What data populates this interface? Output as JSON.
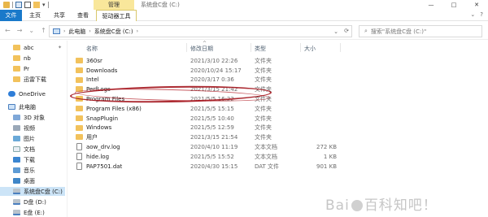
{
  "titlebar": {
    "manage_tab": "管理",
    "window_title": "系统盘C盘 (C:)",
    "minimize": "—",
    "maximize": "□",
    "close": "✕"
  },
  "ribbon": {
    "tabs": [
      "文件",
      "主页",
      "共享",
      "查看",
      "驱动器工具"
    ],
    "expand": "⌄",
    "help": "?"
  },
  "address": {
    "path": [
      "此电脑",
      "系统盘C盘 (C:)"
    ],
    "sep": "›",
    "search_placeholder": "搜索\"系统盘C盘 (C:)\""
  },
  "sidebar": {
    "items": [
      {
        "label": "abc",
        "icon": "folder-icon"
      },
      {
        "label": "nb",
        "icon": "folder-icon"
      },
      {
        "label": "Pr",
        "icon": "folder-icon"
      },
      {
        "label": "迅雷下载",
        "icon": "folder-icon"
      },
      {
        "label": "OneDrive",
        "icon": "cloud-icon"
      },
      {
        "label": "此电脑",
        "icon": "pc-icon"
      },
      {
        "label": "3D 对象",
        "icon": "cube-icon"
      },
      {
        "label": "视频",
        "icon": "video-icon"
      },
      {
        "label": "图片",
        "icon": "picture-icon"
      },
      {
        "label": "文档",
        "icon": "document-icon"
      },
      {
        "label": "下载",
        "icon": "download-icon"
      },
      {
        "label": "音乐",
        "icon": "music-icon"
      },
      {
        "label": "桌面",
        "icon": "desktop-icon"
      },
      {
        "label": "系统盘C盘 (C:)",
        "icon": "drive-icon"
      },
      {
        "label": "D盘 (D:)",
        "icon": "drive-icon"
      },
      {
        "label": "E盘 (E:)",
        "icon": "drive-icon"
      }
    ]
  },
  "columns": {
    "name": "名称",
    "date": "修改日期",
    "type": "类型",
    "size": "大小"
  },
  "files": [
    {
      "name": "360sr",
      "date": "2021/3/10 22:26",
      "type": "文件夹",
      "size": "",
      "kind": "folder"
    },
    {
      "name": "Downloads",
      "date": "2020/10/24 15:17",
      "type": "文件夹",
      "size": "",
      "kind": "folder"
    },
    {
      "name": "Intel",
      "date": "2020/3/17 0:36",
      "type": "文件夹",
      "size": "",
      "kind": "folder"
    },
    {
      "name": "PerfLogs",
      "date": "2021/3/15 21:42",
      "type": "文件夹",
      "size": "",
      "kind": "folder"
    },
    {
      "name": "Program Files",
      "date": "2021/5/5 16:22",
      "type": "文件夹",
      "size": "",
      "kind": "folder"
    },
    {
      "name": "Program Files (x86)",
      "date": "2021/5/5 15:15",
      "type": "文件夹",
      "size": "",
      "kind": "folder"
    },
    {
      "name": "SnapPlugin",
      "date": "2021/5/5 10:40",
      "type": "文件夹",
      "size": "",
      "kind": "folder"
    },
    {
      "name": "Windows",
      "date": "2021/5/5 12:59",
      "type": "文件夹",
      "size": "",
      "kind": "folder"
    },
    {
      "name": "用户",
      "date": "2021/3/15 21:54",
      "type": "文件夹",
      "size": "",
      "kind": "folder"
    },
    {
      "name": "aow_drv.log",
      "date": "2020/4/10 11:19",
      "type": "文本文档",
      "size": "272 KB",
      "kind": "file"
    },
    {
      "name": "hide.log",
      "date": "2021/5/5 15:52",
      "type": "文本文档",
      "size": "1 KB",
      "kind": "file"
    },
    {
      "name": "PAP7501.dat",
      "date": "2020/4/30 15:15",
      "type": "DAT 文件",
      "size": "901 KB",
      "kind": "file"
    }
  ],
  "watermark": {
    "text1": "Bai",
    "text2": "百科",
    "text3": "知吧！"
  }
}
